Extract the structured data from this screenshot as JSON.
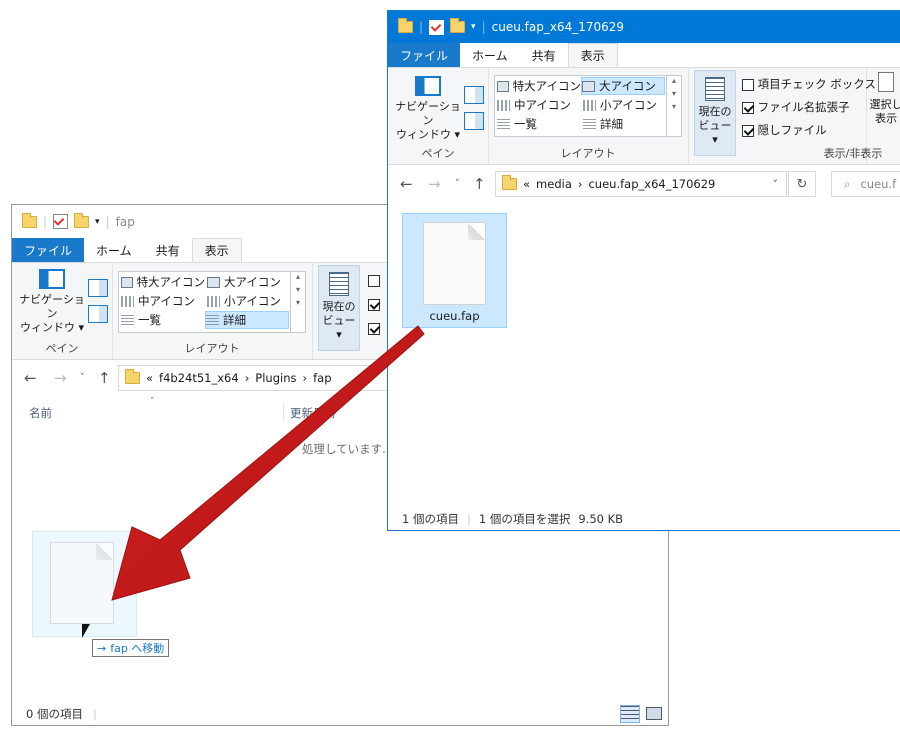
{
  "back_window": {
    "title": "fap",
    "tabs": [
      "ファイル",
      "ホーム",
      "共有",
      "表示"
    ],
    "ribbon": {
      "pane": {
        "nav_pane_line1": "ナビゲーション",
        "nav_pane_line2": "ウィンドウ",
        "group_label": "ペイン"
      },
      "layout": {
        "items": [
          "特大アイコン",
          "大アイコン",
          "中アイコン",
          "小アイコン",
          "一覧",
          "詳細"
        ],
        "selected": "詳細",
        "group_label": "レイアウト"
      },
      "current_view_line1": "現在の",
      "current_view_line2": "ビュー"
    },
    "address": {
      "chevrons": "«",
      "path": [
        "f4b24t51_x64",
        "Plugins",
        "fap"
      ]
    },
    "columns": {
      "name": "名前",
      "modified": "更新日時"
    },
    "processing_text": "処理しています...",
    "drag_tooltip": {
      "arrow": "→",
      "text": "fap へ移動"
    },
    "status": {
      "item_count": "0 個の項目"
    }
  },
  "front_window": {
    "title": "cueu.fap_x64_170629",
    "tabs": [
      "ファイル",
      "ホーム",
      "共有",
      "表示"
    ],
    "ribbon": {
      "pane": {
        "nav_pane_line1": "ナビゲーション",
        "nav_pane_line2": "ウィンドウ",
        "group_label": "ペイン"
      },
      "layout": {
        "items": [
          "特大アイコン",
          "大アイコン",
          "中アイコン",
          "小アイコン",
          "一覧",
          "詳細"
        ],
        "selected": "大アイコン",
        "group_label": "レイアウト"
      },
      "current_view_line1": "現在の",
      "current_view_line2": "ビュー",
      "show_hide": {
        "item_checkbox": "項目チェック ボックス",
        "file_ext": "ファイル名拡張子",
        "hidden_files": "隠しファイル",
        "group_label": "表示/非表示",
        "select_line1": "選択し",
        "select_line2": "表示"
      }
    },
    "address": {
      "chevrons": "«",
      "path": [
        "media",
        "cueu.fap_x64_170629"
      ]
    },
    "search_placeholder": "cueu.f",
    "file": {
      "name": "cueu.fap"
    },
    "status": {
      "item_count": "1 個の項目",
      "selected": "1 個の項目を選択",
      "size": "9.50 KB"
    }
  },
  "colors": {
    "accent": "#0078d7",
    "selection": "#cce8ff",
    "arrow": "#e03131"
  }
}
